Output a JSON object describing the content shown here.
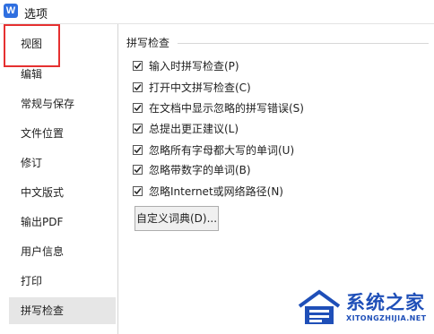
{
  "window": {
    "app_icon_letter": "W",
    "title": "选项"
  },
  "sidebar": {
    "items": [
      {
        "label": "视图"
      },
      {
        "label": "编辑"
      },
      {
        "label": "常规与保存"
      },
      {
        "label": "文件位置"
      },
      {
        "label": "修订"
      },
      {
        "label": "中文版式"
      },
      {
        "label": "输出PDF"
      },
      {
        "label": "用户信息"
      },
      {
        "label": "打印"
      },
      {
        "label": "拼写检查"
      }
    ],
    "active": "拼写检查",
    "highlighted": "编辑"
  },
  "spellcheck": {
    "group_title": "拼写检查",
    "options": [
      {
        "label": "输入时拼写检查(P)",
        "checked": true
      },
      {
        "label": "打开中文拼写检查(C)",
        "checked": true
      },
      {
        "label": "在文档中显示忽略的拼写错误(S)",
        "checked": true
      },
      {
        "label": "总提出更正建议(L)",
        "checked": true
      },
      {
        "label": "忽略所有字母都大写的单词(U)",
        "checked": true
      },
      {
        "label": "忽略带数字的单词(B)",
        "checked": true
      },
      {
        "label": "忽略Internet或网络路径(N)",
        "checked": true
      }
    ],
    "custom_dict_button": "自定义词典(D)..."
  },
  "watermark": {
    "name": "系统之家",
    "url": "XITONGZHIJIA.NET"
  },
  "colors": {
    "highlight_box": "#e53030",
    "active_bg": "#e6e6e6",
    "app_icon": "#2f6fe0",
    "watermark": "#1f4fb8"
  }
}
